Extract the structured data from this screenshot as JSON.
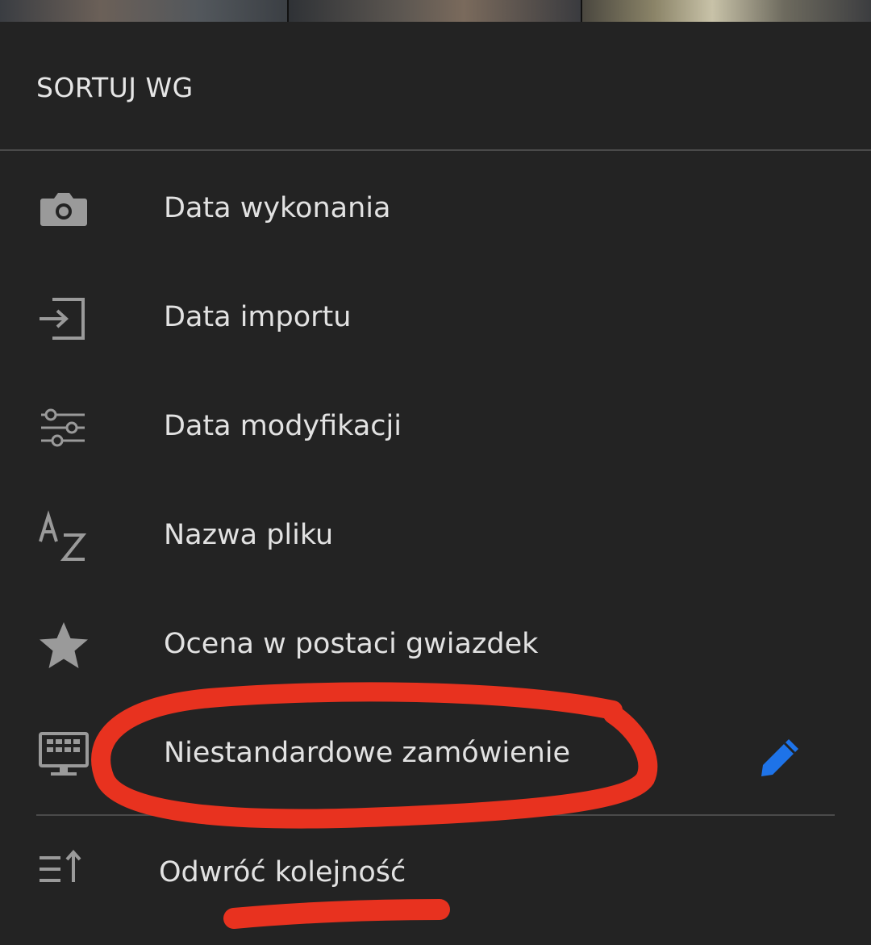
{
  "sheet": {
    "title": "SORTUJ WG"
  },
  "sort_options": [
    {
      "label": "Data wykonania",
      "icon": "camera-icon"
    },
    {
      "label": "Data importu",
      "icon": "import-icon"
    },
    {
      "label": "Data modyfikacji",
      "icon": "sliders-icon"
    },
    {
      "label": "Nazwa pliku",
      "icon": "az-icon"
    },
    {
      "label": "Ocena w postaci gwiazdek",
      "icon": "star-icon"
    },
    {
      "label": "Niestandardowe zamówienie",
      "icon": "monitor-grid-icon",
      "edit_icon": "pencil-icon"
    }
  ],
  "reverse": {
    "label": "Odwróć kolejność",
    "icon": "reverse-order-icon"
  },
  "colors": {
    "background": "#232323",
    "text": "#e2e2e2",
    "icon": "#9a9a9a",
    "divider": "#4a4a4a",
    "accent": "#1e73e8",
    "annotation": "#e8321f"
  }
}
